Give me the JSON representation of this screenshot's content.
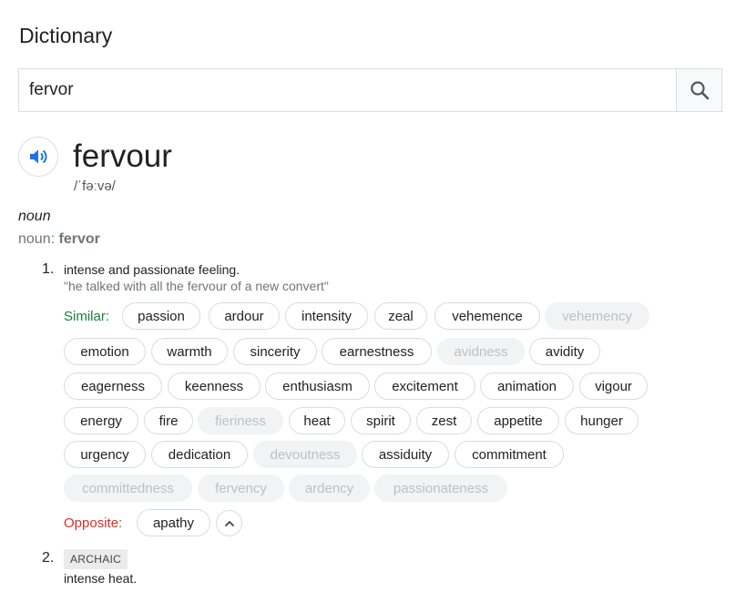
{
  "header": {
    "title": "Dictionary"
  },
  "search": {
    "value": "fervor",
    "placeholder": ""
  },
  "entry": {
    "word": "fervour",
    "phonetic": "/ˈfəːvə/",
    "part_of_speech": "noun",
    "variant_prefix": "noun:",
    "variant_word": "fervor",
    "senses": [
      {
        "number": "1.",
        "definition": "intense and passionate feeling.",
        "example": "\"he talked with all the fervour of a new convert\"",
        "similar_label": "Similar:",
        "similar": [
          "passion",
          "ardour",
          "intensity",
          "zeal",
          "vehemence",
          "vehemency",
          "emotion",
          "warmth",
          "sincerity",
          "earnestness",
          "avidness",
          "avidity",
          "eagerness",
          "keenness",
          "enthusiasm",
          "excitement",
          "animation",
          "vigour",
          "energy",
          "fire",
          "fieriness",
          "heat",
          "spirit",
          "zest",
          "appetite",
          "hunger",
          "urgency",
          "dedication",
          "devoutness",
          "assiduity",
          "commitment",
          "committedness",
          "fervency",
          "ardency",
          "passionateness"
        ],
        "opposite_label": "Opposite:",
        "opposite": [
          "apathy"
        ]
      },
      {
        "number": "2.",
        "tag": "ARCHAIC",
        "definition": "intense heat."
      }
    ]
  }
}
